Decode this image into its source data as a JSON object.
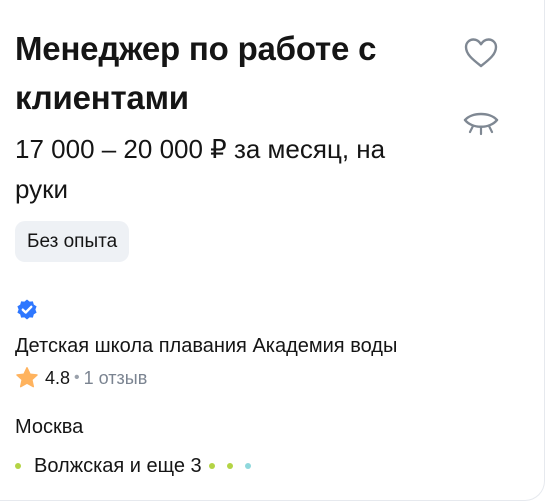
{
  "vacancy": {
    "title": "Менеджер по работе с клиентами",
    "salary": "17 000 – 20 000 ₽ за месяц, на руки",
    "experience_chip": "Без опыта"
  },
  "actions": {
    "favorite_icon": "heart-icon",
    "hide_icon": "closed-eye-icon"
  },
  "employer": {
    "verified_icon": "verified-badge-icon",
    "name": "Детская школа плавания Академия воды",
    "rating": "4.8",
    "separator": "•",
    "reviews": "1 отзыв"
  },
  "location": {
    "city": "Москва",
    "metro": "Волжская и еще 3",
    "metro_colors": [
      "#b4d445",
      "#b4d445",
      "#b4d445",
      "#8fd8dc"
    ]
  },
  "colors": {
    "accent": "#2e77ff",
    "star": "#ffb35e",
    "chip_bg": "#eef1f5",
    "icon_stroke": "#7f8893"
  }
}
